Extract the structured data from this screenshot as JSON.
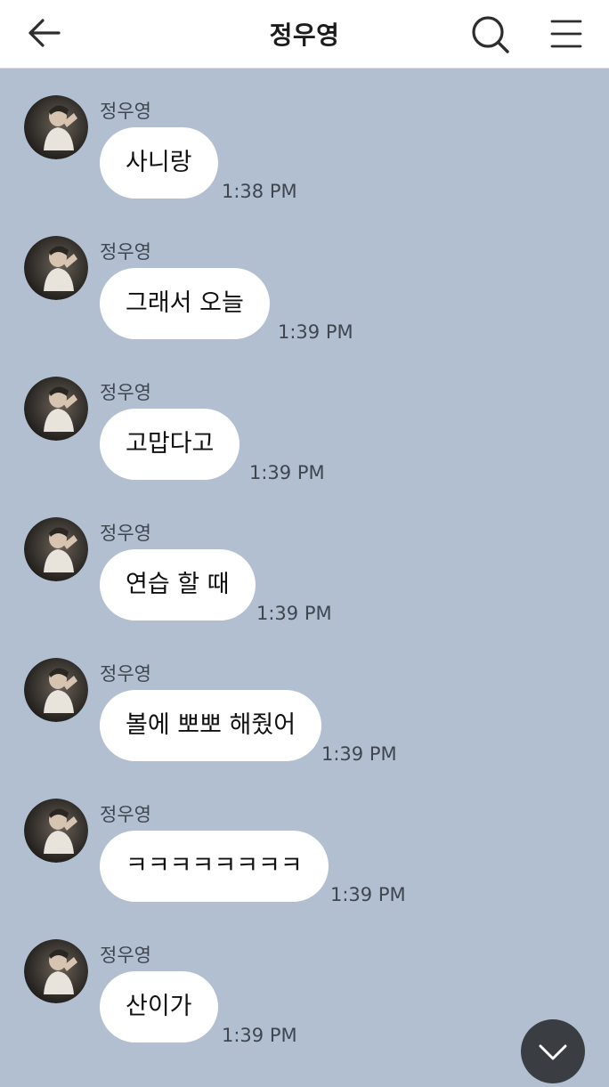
{
  "header": {
    "title": "정우영",
    "back_icon": "arrow-left-icon",
    "search_icon": "search-icon",
    "menu_icon": "hamburger-menu-icon"
  },
  "messages": [
    {
      "sender": "정우영",
      "text": "사니랑",
      "time": "1:38 PM"
    },
    {
      "sender": "정우영",
      "text": "그래서 오늘",
      "time": "1:39 PM"
    },
    {
      "sender": "정우영",
      "text": "고맙다고",
      "time": "1:39 PM"
    },
    {
      "sender": "정우영",
      "text": "연습 할 때",
      "time": "1:39 PM"
    },
    {
      "sender": "정우영",
      "text": "볼에 뽀뽀 해줬어",
      "time": "1:39 PM"
    },
    {
      "sender": "정우영",
      "text": "ㅋㅋㅋㅋㅋㅋㅋㅋ",
      "time": "1:39 PM"
    },
    {
      "sender": "정우영",
      "text": "산이가",
      "time": "1:39 PM"
    }
  ],
  "scroll_button": {
    "icon": "chevron-down-icon"
  },
  "colors": {
    "chat_background": "#b1bfd0",
    "bubble": "#ffffff",
    "header": "#ffffff"
  }
}
